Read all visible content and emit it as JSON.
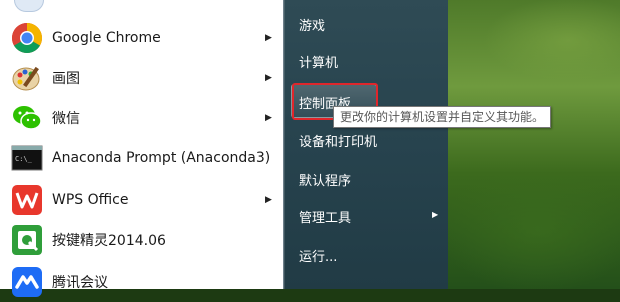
{
  "programs": [
    {
      "name": "Google Chrome",
      "icon": "chrome-icon",
      "has_submenu": true
    },
    {
      "name": "画图",
      "icon": "paint-icon",
      "has_submenu": true
    },
    {
      "name": "微信",
      "icon": "wechat-icon",
      "has_submenu": true
    },
    {
      "name": "Anaconda Prompt (Anaconda3)",
      "icon": "terminal-icon",
      "has_submenu": false
    },
    {
      "name": "WPS Office",
      "icon": "wps-icon",
      "has_submenu": true
    },
    {
      "name": "按键精灵2014.06",
      "icon": "anjian-icon",
      "has_submenu": false
    },
    {
      "name": "腾讯会议",
      "icon": "tencent-meeting-icon",
      "has_submenu": false
    }
  ],
  "right_menu": [
    {
      "label": "游戏",
      "has_submenu": false
    },
    {
      "label": "计算机",
      "has_submenu": false
    },
    {
      "label": "控制面板",
      "has_submenu": false
    },
    {
      "label": "设备和打印机",
      "has_submenu": false
    },
    {
      "label": "默认程序",
      "has_submenu": false
    },
    {
      "label": "管理工具",
      "has_submenu": true
    },
    {
      "label": "运行...",
      "has_submenu": false
    }
  ],
  "tooltip": "更改你的计算机设置并自定义其功能。",
  "colors": {
    "highlight": "#e0262b",
    "right_pane": "#27434e"
  }
}
